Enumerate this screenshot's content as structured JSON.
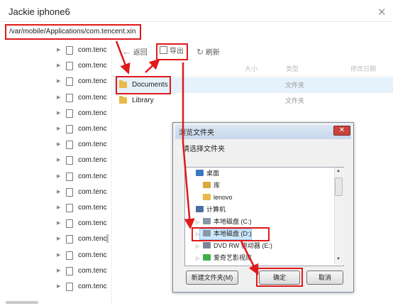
{
  "window": {
    "title": "Jackie iphone6",
    "close_glyph": "✕"
  },
  "path": "/var/mobile/Applications/com.tencent.xin",
  "tree": {
    "items": [
      "com.tenc",
      "com.tenc",
      "com.tenc",
      "com.tenc",
      "com.tenc",
      "com.tenc",
      "com.tenc",
      "com.tenc",
      "com.tenc",
      "com.tenc",
      "com.tenc",
      "com.tenc",
      "com.tenc",
      "com.tenc",
      "com.tenc",
      "com.tenc"
    ]
  },
  "toolbar": {
    "back": "返回",
    "export": "导出",
    "refresh": "刷新"
  },
  "columns": {
    "size": "大小",
    "type": "类型",
    "modified": "修改日期"
  },
  "files": [
    {
      "name": "Documents",
      "type": "文件夹"
    },
    {
      "name": "Library",
      "type": "文件夹"
    }
  ],
  "dialog": {
    "title": "浏览文件夹",
    "prompt": "请选择文件夹",
    "close_glyph": "✕",
    "tree": [
      {
        "label": "桌面",
        "icon": "desktop-icon"
      },
      {
        "label": "库",
        "icon": "library-icon"
      },
      {
        "label": "lenovo",
        "icon": "user-folder-icon"
      },
      {
        "label": "计算机",
        "icon": "computer-icon"
      },
      {
        "label": "本地磁盘 (C:)",
        "icon": "drive-icon"
      },
      {
        "label": "本地磁盘 (D:)",
        "icon": "drive-icon"
      },
      {
        "label": "DVD RW 驱动器 (E:)",
        "icon": "dvd-icon"
      },
      {
        "label": "爱奇艺影视库",
        "icon": "app-folder-icon"
      }
    ],
    "buttons": {
      "new_folder": "新建文件夹(M)",
      "ok": "确定",
      "cancel": "取消"
    }
  },
  "colors": {
    "highlight_red": "#e0191b",
    "selection_blue": "#cde8ff",
    "folder": "#e9b94a"
  }
}
